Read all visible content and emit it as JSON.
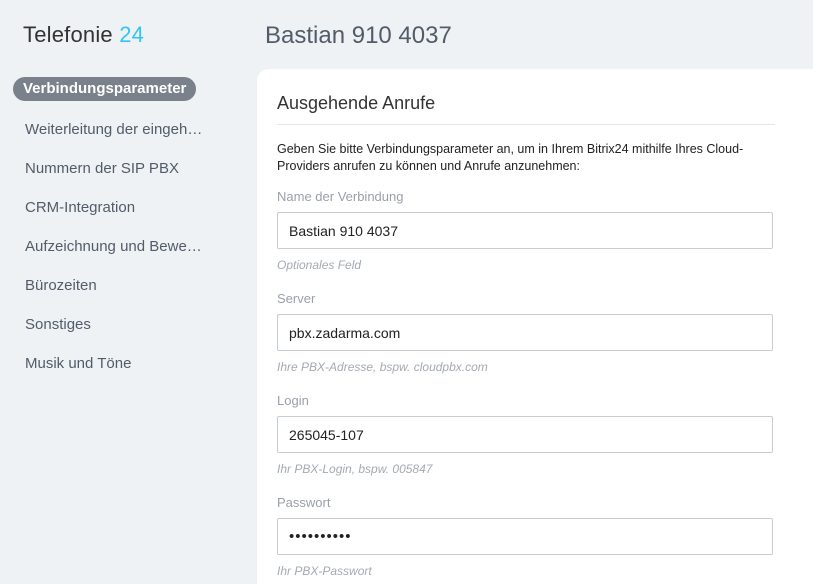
{
  "app": {
    "title_main": "Telefonie",
    "title_accent": "24"
  },
  "page": {
    "title": "Bastian 910 4037"
  },
  "sidebar": {
    "items": [
      {
        "label": "Verbindungsparameter",
        "active": true
      },
      {
        "label": "Weiterleitung der eingehenden Anrufe"
      },
      {
        "label": "Nummern der SIP PBX"
      },
      {
        "label": "CRM-Integration"
      },
      {
        "label": "Aufzeichnung und Bewertung"
      },
      {
        "label": "Bürozeiten"
      },
      {
        "label": "Sonstiges"
      },
      {
        "label": "Musik und Töne"
      }
    ]
  },
  "main": {
    "section_title": "Ausgehende Anrufe",
    "intro": "Geben Sie bitte Verbindungsparameter an, um in Ihrem Bitrix24 mithilfe Ihres Cloud-Providers anrufen zu können und Anrufe anzunehmen:",
    "fields": {
      "name": {
        "label": "Name der Verbindung",
        "value": "Bastian 910 4037",
        "hint": "Optionales Feld"
      },
      "server": {
        "label": "Server",
        "value": "pbx.zadarma.com",
        "hint": "Ihre PBX-Adresse, bspw. cloudpbx.com"
      },
      "login": {
        "label": "Login",
        "value": "265045-107",
        "hint": "Ihr PBX-Login, bspw. 005847"
      },
      "password": {
        "label": "Passwort",
        "value": "••••••••••",
        "hint": "Ihr PBX-Passwort"
      }
    }
  },
  "colors": {
    "accent": "#2fc6f6",
    "active_nav_bg": "#7a818a",
    "background": "#eef2f4"
  }
}
